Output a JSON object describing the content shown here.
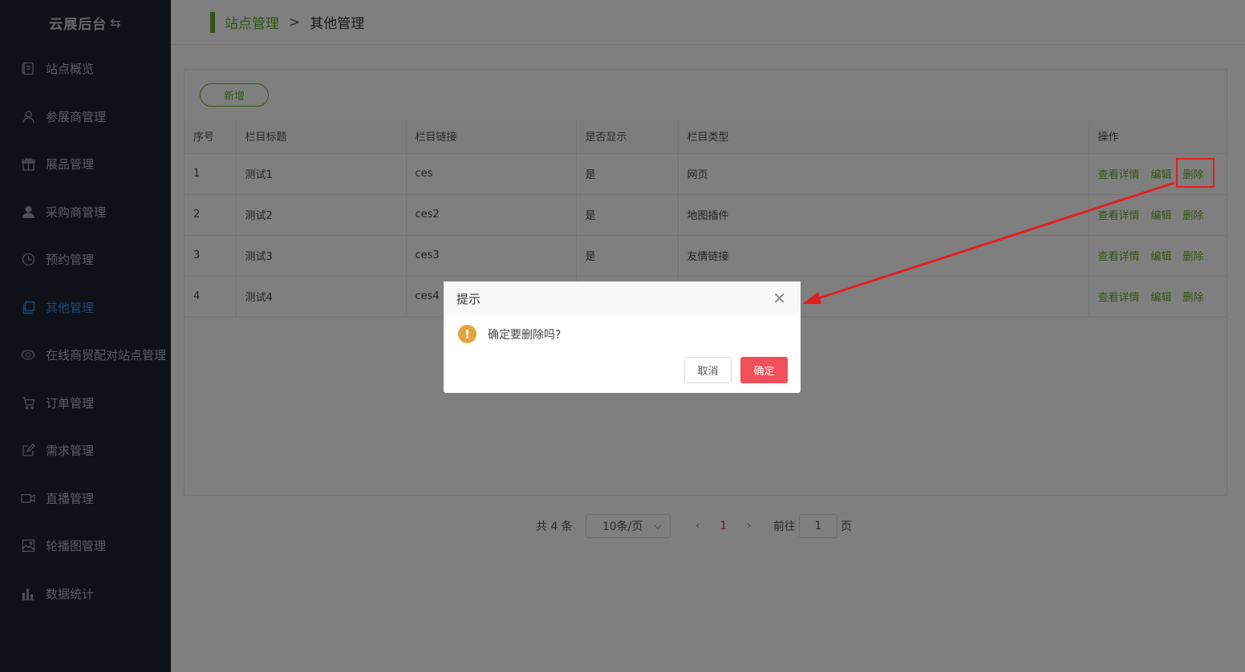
{
  "brand": {
    "title": "云展后台",
    "swap_glyph": "⇆"
  },
  "sidebar": {
    "items": [
      {
        "label": "站点概览",
        "icon": "document-icon"
      },
      {
        "label": "参展商管理",
        "icon": "user-icon"
      },
      {
        "label": "展品管理",
        "icon": "gift-icon"
      },
      {
        "label": "采购商管理",
        "icon": "person-icon"
      },
      {
        "label": "预约管理",
        "icon": "clock-icon"
      },
      {
        "label": "其他管理",
        "icon": "copy-icon",
        "active": true
      },
      {
        "label": "在线商贸配对站点管理",
        "icon": "eye-icon"
      },
      {
        "label": "订单管理",
        "icon": "cart-icon"
      },
      {
        "label": "需求管理",
        "icon": "edit-icon"
      },
      {
        "label": "直播管理",
        "icon": "video-icon"
      },
      {
        "label": "轮播图管理",
        "icon": "picture-icon"
      },
      {
        "label": "数据统计",
        "icon": "bar-chart-icon"
      }
    ]
  },
  "breadcrumb": {
    "level1": "站点管理",
    "separator": ">",
    "level2": "其他管理"
  },
  "toolbar": {
    "add_label": "新增"
  },
  "table": {
    "headers": [
      "序号",
      "栏目标题",
      "栏目链接",
      "是否显示",
      "栏目类型",
      "操作"
    ],
    "rows": [
      [
        "1",
        "测试1",
        "ces",
        "是",
        "网页"
      ],
      [
        "2",
        "测试2",
        "ces2",
        "是",
        "地图插件"
      ],
      [
        "3",
        "测试3",
        "ces3",
        "是",
        "友情链接"
      ],
      [
        "4",
        "测试4",
        "ces4",
        "",
        ""
      ]
    ],
    "actions": {
      "view": "查看详情",
      "edit": "编辑",
      "delete": "删除"
    }
  },
  "pagination": {
    "total": "共 4 条",
    "page_size": "10条/页",
    "prev": "‹",
    "current": "1",
    "next": "›",
    "goto_prefix": "前往",
    "goto_value": "1",
    "goto_suffix": "页"
  },
  "dialog": {
    "title": "提示",
    "close_glyph": "✕",
    "warn_glyph": "!",
    "message": "确定要删除吗?",
    "cancel_label": "取消",
    "confirm_label": "确定"
  },
  "colors": {
    "sidebar_bg": "#1c2431",
    "accent_green": "#66a82a",
    "active_blue": "#3f8fe8",
    "confirm_red": "#f0505a",
    "annotation_red": "#e02020",
    "warning_orange": "#e6a23c"
  }
}
